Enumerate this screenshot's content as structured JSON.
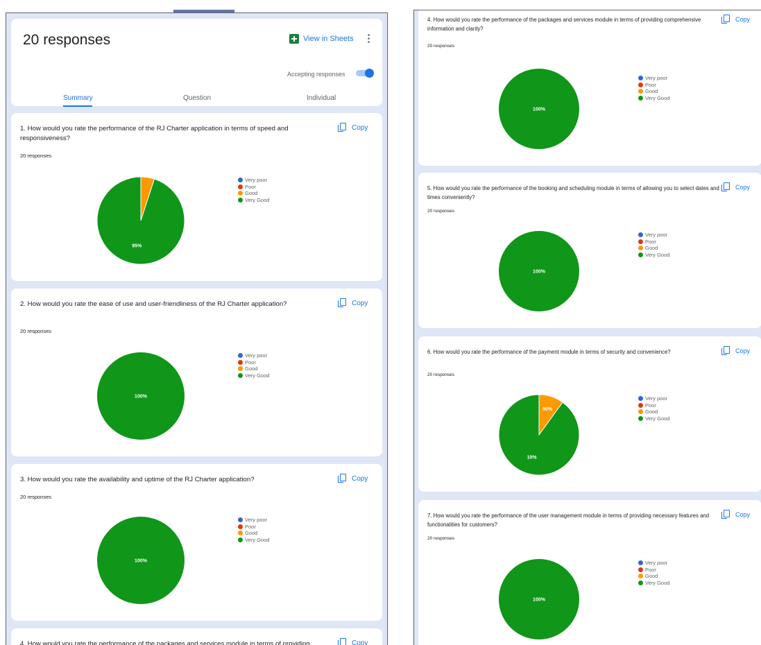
{
  "header": {
    "response_count": "20 responses",
    "view_in_sheets": "View in Sheets",
    "accepting": "Accepting responses",
    "tabs": [
      "Summary",
      "Question",
      "Individual"
    ]
  },
  "legend": [
    "Very poor",
    "Poor",
    "Good",
    "Very Good"
  ],
  "colors": {
    "very_poor": "#3366cc",
    "poor": "#dc3912",
    "good": "#ff9900",
    "very_good": "#109618",
    "accent": "#1a73e8"
  },
  "copy_label": "Copy",
  "questions": [
    {
      "text": "1. How would you rate the performance of the RJ Charter application in terms of speed and responsiveness?",
      "count": "20 responses",
      "chart_data": {
        "type": "pie",
        "categories": [
          "Very poor",
          "Poor",
          "Good",
          "Very Good"
        ],
        "values": [
          0,
          0,
          5,
          95
        ],
        "slice_labels": [
          "95%"
        ]
      }
    },
    {
      "text": "2. How would you rate the ease of use and user-friendliness of the RJ Charter application?",
      "count": "20 responses",
      "chart_data": {
        "type": "pie",
        "categories": [
          "Very poor",
          "Poor",
          "Good",
          "Very Good"
        ],
        "values": [
          0,
          0,
          0,
          100
        ],
        "slice_labels": [
          "100%"
        ]
      }
    },
    {
      "text": "3. How would you rate the availability and uptime of the RJ Charter application?",
      "count": "20 responses",
      "chart_data": {
        "type": "pie",
        "categories": [
          "Very poor",
          "Poor",
          "Good",
          "Very Good"
        ],
        "values": [
          0,
          0,
          0,
          100
        ],
        "slice_labels": [
          "100%"
        ]
      }
    },
    {
      "text": "4. How would you rate the performance of the packages and services module in terms of providing comprehensive information and clarity?",
      "count": "20 responses",
      "chart_data": {
        "type": "pie",
        "categories": [
          "Very poor",
          "Poor",
          "Good",
          "Very Good"
        ],
        "values": [
          0,
          0,
          0,
          100
        ],
        "slice_labels": [
          "100%"
        ]
      }
    },
    {
      "text": "5. How would you rate the performance of the booking and scheduling module in terms of allowing you to select dates and times conveniently?",
      "count": "20 responses",
      "chart_data": {
        "type": "pie",
        "categories": [
          "Very poor",
          "Poor",
          "Good",
          "Very Good"
        ],
        "values": [
          0,
          0,
          0,
          100
        ],
        "slice_labels": [
          "100%"
        ]
      }
    },
    {
      "text": "6. How would you rate the performance of the payment module in terms of security and convenience?",
      "count": "20 responses",
      "chart_data": {
        "type": "pie",
        "categories": [
          "Very poor",
          "Poor",
          "Good",
          "Very Good"
        ],
        "values": [
          0,
          0,
          10,
          90
        ],
        "slice_labels": [
          "90%",
          "10%"
        ]
      }
    },
    {
      "text": "7. How would you rate the performance of the user management module in terms of providing necessary features and functionalities for customers?",
      "count": "20 responses",
      "chart_data": {
        "type": "pie",
        "categories": [
          "Very poor",
          "Poor",
          "Good",
          "Very Good"
        ],
        "values": [
          0,
          0,
          0,
          100
        ],
        "slice_labels": [
          "100%"
        ]
      }
    }
  ]
}
